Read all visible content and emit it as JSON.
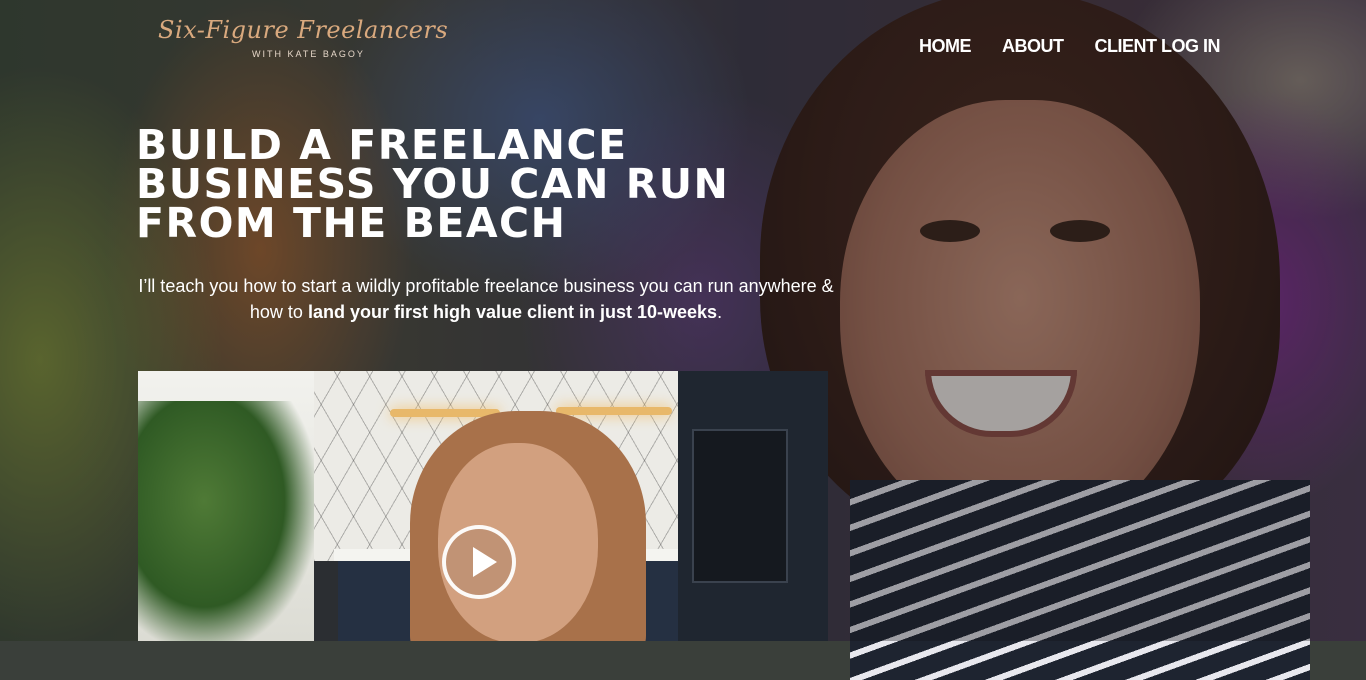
{
  "logo": {
    "script_text": "Six-Figure Freelancers",
    "tagline": "WITH KATE BAGOY"
  },
  "nav": {
    "items": [
      {
        "label": "HOME"
      },
      {
        "label": "ABOUT"
      },
      {
        "label": "CLIENT LOG IN"
      }
    ]
  },
  "hero": {
    "headline": "BUILD A FREELANCE\nBUSINESS YOU CAN RUN\nFROM THE BEACH",
    "subtext_plain": "I’ll teach you how to start a wildly profitable freelance business you can run anywhere & how to ",
    "subtext_bold": "land your first high value client in just 10-weeks",
    "subtext_end": "."
  },
  "video": {
    "play_icon": "play-icon"
  },
  "colors": {
    "logo_script": "#d9a97e",
    "text": "#ffffff"
  }
}
